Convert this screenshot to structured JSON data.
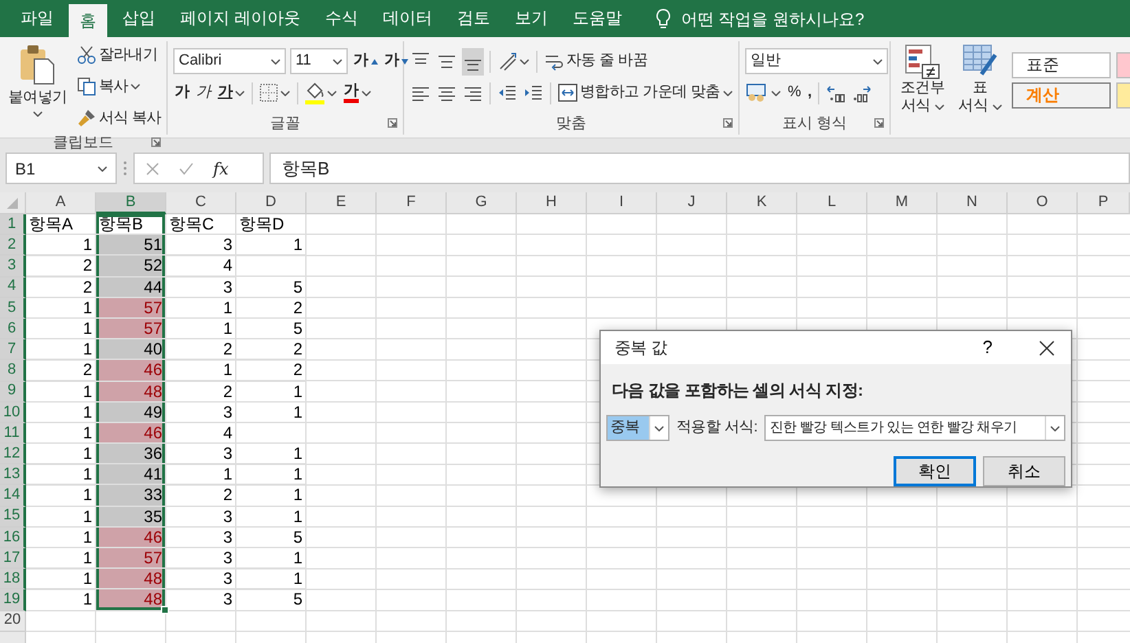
{
  "tabs": [
    {
      "label": "파일",
      "selected": false
    },
    {
      "label": "홈",
      "selected": true
    },
    {
      "label": "삽입",
      "selected": false
    },
    {
      "label": "페이지 레이아웃",
      "selected": false
    },
    {
      "label": "수식",
      "selected": false
    },
    {
      "label": "데이터",
      "selected": false
    },
    {
      "label": "검토",
      "selected": false
    },
    {
      "label": "보기",
      "selected": false
    },
    {
      "label": "도움말",
      "selected": false
    }
  ],
  "tell_me": "어떤 작업을 원하시나요?",
  "clipboard": {
    "paste": "붙여넣기",
    "cut": "잘라내기",
    "copy": "복사",
    "format_painter": "서식 복사",
    "label": "클립보드"
  },
  "font": {
    "name": "Calibri",
    "size": "11",
    "grow": "가",
    "shrink": "가",
    "bold": "가",
    "italic": "가",
    "underline": "가",
    "font_color": "가",
    "label": "글꼴"
  },
  "alignment": {
    "vertical": [
      {
        "kind": "top",
        "selected": false
      },
      {
        "kind": "middle",
        "selected": false
      },
      {
        "kind": "bottom",
        "selected": true
      }
    ],
    "wrap": "자동 줄 바꿈",
    "merge": "병합하고 가운데 맞춤",
    "label": "맞춤"
  },
  "number": {
    "format": "일반",
    "percent": "%",
    "comma": ",",
    "label": "표시 형식"
  },
  "styles": {
    "conditional": [
      "조건부",
      "서식"
    ],
    "table": [
      "표",
      "서식"
    ],
    "cell_styles": [
      {
        "label": "표준",
        "kind": "normal"
      },
      {
        "label": "계산",
        "kind": "calculation"
      }
    ]
  },
  "formula_bar": {
    "name_box": "B1",
    "function_label": "fx",
    "formula": "항목B"
  },
  "grid": {
    "columns": [
      {
        "label": "A",
        "selected": false
      },
      {
        "label": "B",
        "selected": true
      },
      {
        "label": "C",
        "selected": false
      },
      {
        "label": "D",
        "selected": false
      },
      {
        "label": "E",
        "selected": false
      },
      {
        "label": "F",
        "selected": false
      },
      {
        "label": "G",
        "selected": false
      },
      {
        "label": "H",
        "selected": false
      },
      {
        "label": "I",
        "selected": false
      },
      {
        "label": "J",
        "selected": false
      },
      {
        "label": "K",
        "selected": false
      },
      {
        "label": "L",
        "selected": false
      },
      {
        "label": "M",
        "selected": false
      },
      {
        "label": "N",
        "selected": false
      },
      {
        "label": "O",
        "selected": false
      },
      {
        "label": "P",
        "selected": false
      }
    ],
    "rows": [
      {
        "number": "1",
        "selected": true,
        "cells": [
          {
            "text": "항목A",
            "kind": "label",
            "selected": false,
            "duplicate": false
          },
          {
            "text": "항목B",
            "kind": "label",
            "selected": false,
            "duplicate": false
          },
          {
            "text": "항목C",
            "kind": "label",
            "selected": false,
            "duplicate": false
          },
          {
            "text": "항목D",
            "kind": "label",
            "selected": false,
            "duplicate": false
          }
        ]
      },
      {
        "number": "2",
        "selected": true,
        "cells": [
          {
            "text": "1",
            "kind": "number",
            "selected": false,
            "duplicate": false
          },
          {
            "text": "51",
            "kind": "number",
            "selected": true,
            "duplicate": false
          },
          {
            "text": "3",
            "kind": "number",
            "selected": false,
            "duplicate": false
          },
          {
            "text": "1",
            "kind": "number",
            "selected": false,
            "duplicate": false
          }
        ]
      },
      {
        "number": "3",
        "selected": true,
        "cells": [
          {
            "text": "2",
            "kind": "number",
            "selected": false,
            "duplicate": false
          },
          {
            "text": "52",
            "kind": "number",
            "selected": true,
            "duplicate": false
          },
          {
            "text": "4",
            "kind": "number",
            "selected": false,
            "duplicate": false
          },
          {
            "kind": "empty",
            "selected": false,
            "duplicate": false
          }
        ]
      },
      {
        "number": "4",
        "selected": true,
        "cells": [
          {
            "text": "2",
            "kind": "number",
            "selected": false,
            "duplicate": false
          },
          {
            "text": "44",
            "kind": "number",
            "selected": true,
            "duplicate": false
          },
          {
            "text": "3",
            "kind": "number",
            "selected": false,
            "duplicate": false
          },
          {
            "text": "5",
            "kind": "number",
            "selected": false,
            "duplicate": false
          }
        ]
      },
      {
        "number": "5",
        "selected": true,
        "cells": [
          {
            "text": "1",
            "kind": "number",
            "selected": false,
            "duplicate": false
          },
          {
            "text": "57",
            "kind": "number",
            "selected": true,
            "duplicate": true
          },
          {
            "text": "1",
            "kind": "number",
            "selected": false,
            "duplicate": false
          },
          {
            "text": "2",
            "kind": "number",
            "selected": false,
            "duplicate": false
          }
        ]
      },
      {
        "number": "6",
        "selected": true,
        "cells": [
          {
            "text": "1",
            "kind": "number",
            "selected": false,
            "duplicate": false
          },
          {
            "text": "57",
            "kind": "number",
            "selected": true,
            "duplicate": true
          },
          {
            "text": "1",
            "kind": "number",
            "selected": false,
            "duplicate": false
          },
          {
            "text": "5",
            "kind": "number",
            "selected": false,
            "duplicate": false
          }
        ]
      },
      {
        "number": "7",
        "selected": true,
        "cells": [
          {
            "text": "1",
            "kind": "number",
            "selected": false,
            "duplicate": false
          },
          {
            "text": "40",
            "kind": "number",
            "selected": true,
            "duplicate": false
          },
          {
            "text": "2",
            "kind": "number",
            "selected": false,
            "duplicate": false
          },
          {
            "text": "2",
            "kind": "number",
            "selected": false,
            "duplicate": false
          }
        ]
      },
      {
        "number": "8",
        "selected": true,
        "cells": [
          {
            "text": "2",
            "kind": "number",
            "selected": false,
            "duplicate": false
          },
          {
            "text": "46",
            "kind": "number",
            "selected": true,
            "duplicate": true
          },
          {
            "text": "1",
            "kind": "number",
            "selected": false,
            "duplicate": false
          },
          {
            "text": "2",
            "kind": "number",
            "selected": false,
            "duplicate": false
          }
        ]
      },
      {
        "number": "9",
        "selected": true,
        "cells": [
          {
            "text": "1",
            "kind": "number",
            "selected": false,
            "duplicate": false
          },
          {
            "text": "48",
            "kind": "number",
            "selected": true,
            "duplicate": true
          },
          {
            "text": "2",
            "kind": "number",
            "selected": false,
            "duplicate": false
          },
          {
            "text": "1",
            "kind": "number",
            "selected": false,
            "duplicate": false
          }
        ]
      },
      {
        "number": "10",
        "selected": true,
        "cells": [
          {
            "text": "1",
            "kind": "number",
            "selected": false,
            "duplicate": false
          },
          {
            "text": "49",
            "kind": "number",
            "selected": true,
            "duplicate": false
          },
          {
            "text": "3",
            "kind": "number",
            "selected": false,
            "duplicate": false
          },
          {
            "text": "1",
            "kind": "number",
            "selected": false,
            "duplicate": false
          }
        ]
      },
      {
        "number": "11",
        "selected": true,
        "cells": [
          {
            "text": "1",
            "kind": "number",
            "selected": false,
            "duplicate": false
          },
          {
            "text": "46",
            "kind": "number",
            "selected": true,
            "duplicate": true
          },
          {
            "text": "4",
            "kind": "number",
            "selected": false,
            "duplicate": false
          },
          {
            "kind": "empty",
            "selected": false,
            "duplicate": false
          }
        ]
      },
      {
        "number": "12",
        "selected": true,
        "cells": [
          {
            "text": "1",
            "kind": "number",
            "selected": false,
            "duplicate": false
          },
          {
            "text": "36",
            "kind": "number",
            "selected": true,
            "duplicate": false
          },
          {
            "text": "3",
            "kind": "number",
            "selected": false,
            "duplicate": false
          },
          {
            "text": "1",
            "kind": "number",
            "selected": false,
            "duplicate": false
          }
        ]
      },
      {
        "number": "13",
        "selected": true,
        "cells": [
          {
            "text": "1",
            "kind": "number",
            "selected": false,
            "duplicate": false
          },
          {
            "text": "41",
            "kind": "number",
            "selected": true,
            "duplicate": false
          },
          {
            "text": "1",
            "kind": "number",
            "selected": false,
            "duplicate": false
          },
          {
            "text": "1",
            "kind": "number",
            "selected": false,
            "duplicate": false
          }
        ]
      },
      {
        "number": "14",
        "selected": true,
        "cells": [
          {
            "text": "1",
            "kind": "number",
            "selected": false,
            "duplicate": false
          },
          {
            "text": "33",
            "kind": "number",
            "selected": true,
            "duplicate": false
          },
          {
            "text": "2",
            "kind": "number",
            "selected": false,
            "duplicate": false
          },
          {
            "text": "1",
            "kind": "number",
            "selected": false,
            "duplicate": false
          }
        ]
      },
      {
        "number": "15",
        "selected": true,
        "cells": [
          {
            "text": "1",
            "kind": "number",
            "selected": false,
            "duplicate": false
          },
          {
            "text": "35",
            "kind": "number",
            "selected": true,
            "duplicate": false
          },
          {
            "text": "3",
            "kind": "number",
            "selected": false,
            "duplicate": false
          },
          {
            "text": "1",
            "kind": "number",
            "selected": false,
            "duplicate": false
          }
        ]
      },
      {
        "number": "16",
        "selected": true,
        "cells": [
          {
            "text": "1",
            "kind": "number",
            "selected": false,
            "duplicate": false
          },
          {
            "text": "46",
            "kind": "number",
            "selected": true,
            "duplicate": true
          },
          {
            "text": "3",
            "kind": "number",
            "selected": false,
            "duplicate": false
          },
          {
            "text": "5",
            "kind": "number",
            "selected": false,
            "duplicate": false
          }
        ]
      },
      {
        "number": "17",
        "selected": true,
        "cells": [
          {
            "text": "1",
            "kind": "number",
            "selected": false,
            "duplicate": false
          },
          {
            "text": "57",
            "kind": "number",
            "selected": true,
            "duplicate": true
          },
          {
            "text": "3",
            "kind": "number",
            "selected": false,
            "duplicate": false
          },
          {
            "text": "1",
            "kind": "number",
            "selected": false,
            "duplicate": false
          }
        ]
      },
      {
        "number": "18",
        "selected": true,
        "cells": [
          {
            "text": "1",
            "kind": "number",
            "selected": false,
            "duplicate": false
          },
          {
            "text": "48",
            "kind": "number",
            "selected": true,
            "duplicate": true
          },
          {
            "text": "3",
            "kind": "number",
            "selected": false,
            "duplicate": false
          },
          {
            "text": "1",
            "kind": "number",
            "selected": false,
            "duplicate": false
          }
        ]
      },
      {
        "number": "19",
        "selected": true,
        "cells": [
          {
            "text": "1",
            "kind": "number",
            "selected": false,
            "duplicate": false
          },
          {
            "text": "48",
            "kind": "number",
            "selected": true,
            "duplicate": true
          },
          {
            "text": "3",
            "kind": "number",
            "selected": false,
            "duplicate": false
          },
          {
            "text": "5",
            "kind": "number",
            "selected": false,
            "duplicate": false
          }
        ]
      },
      {
        "number": "20",
        "selected": false
      }
    ]
  },
  "dialog": {
    "title": "중복 값",
    "help": "?",
    "prompt": "다음 값을 포함하는 셀의 서식 지정:",
    "rule": "중복",
    "apply_label": "적용할 서식:",
    "format": "진한 빨강 텍스트가 있는 연한 빨강 채우기",
    "buttons": [
      {
        "label": "확인",
        "default": true
      },
      {
        "label": "취소",
        "default": false
      }
    ]
  }
}
